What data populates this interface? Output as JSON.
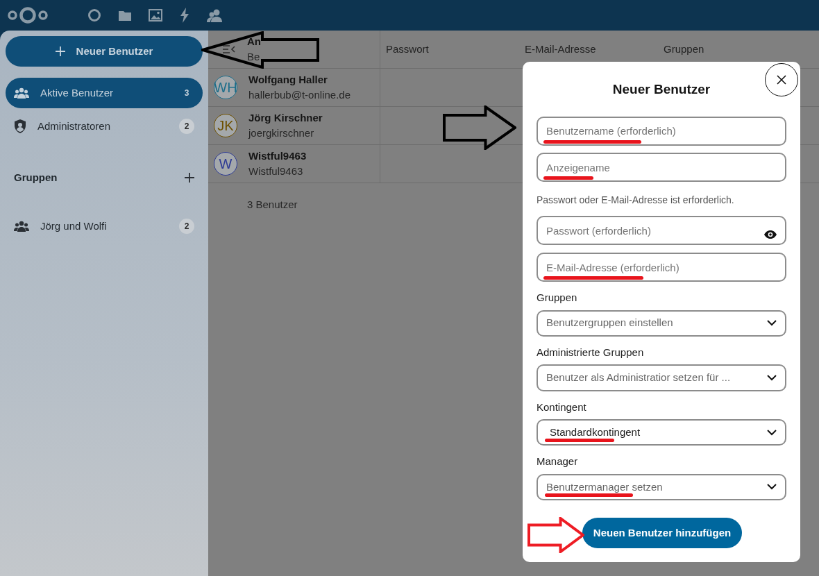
{
  "sidebar": {
    "new_user_button": "Neuer Benutzer",
    "items": [
      {
        "label": "Aktive Benutzer",
        "count": "3",
        "selected": true,
        "kind": "users"
      },
      {
        "label": "Administratoren",
        "count": "2",
        "selected": false,
        "kind": "admins"
      }
    ],
    "groups_heading": "Gruppen",
    "groups": [
      {
        "label": "Jörg und Wolfi",
        "count": "2",
        "selected": false
      }
    ]
  },
  "table": {
    "columns": [
      {
        "label": "An",
        "sublabel": "Be"
      },
      {
        "label": "Passwort"
      },
      {
        "label": "E-Mail-Adresse"
      },
      {
        "label": "Gruppen"
      }
    ],
    "rows": [
      {
        "initials": "WH",
        "color": "#1d6e8a",
        "display_name": "Wolfgang Haller",
        "username": "hallerbub@t-online.de"
      },
      {
        "initials": "JK",
        "color": "#6e5000",
        "display_name": "Jörg Kirschner",
        "username": "joergkirschner"
      },
      {
        "initials": "W",
        "color": "#2d3a94",
        "display_name": "Wistful9463",
        "username": "Wistful9463"
      }
    ],
    "footer": "3 Benutzer"
  },
  "dialog": {
    "title": "Neuer Benutzer",
    "fields": [
      {
        "kind": "input",
        "placeholder": "Benutzername (erforderlich)",
        "marked": true
      },
      {
        "kind": "input",
        "placeholder": "Anzeigename",
        "marked": true
      },
      {
        "kind": "note",
        "text": "Passwort oder E-Mail-Adresse ist erforderlich."
      },
      {
        "kind": "password",
        "placeholder": "Passwort (erforderlich)",
        "marked": false
      },
      {
        "kind": "input",
        "placeholder": "E-Mail-Adresse (erforderlich)",
        "marked": true
      },
      {
        "kind": "select",
        "label": "Gruppen",
        "placeholder": "Benutzergruppen einstellen",
        "marked": false
      },
      {
        "kind": "select",
        "label": "Administrierte Gruppen",
        "placeholder": "Benutzer als Administratior setzen für ...",
        "marked": false
      },
      {
        "kind": "select",
        "label": "Kontingent",
        "value": "Standardkontingent",
        "marked": true
      },
      {
        "kind": "select",
        "label": "Manager",
        "placeholder": "Benutzermanager setzen",
        "marked": true
      }
    ],
    "submit_button": "Neuen Benutzer hinzufügen"
  },
  "annotations": [
    {
      "kind": "arrow",
      "color": "#000000"
    },
    {
      "kind": "arrow",
      "color": "#000000"
    },
    {
      "kind": "arrow",
      "color": "#ee1c24"
    }
  ]
}
